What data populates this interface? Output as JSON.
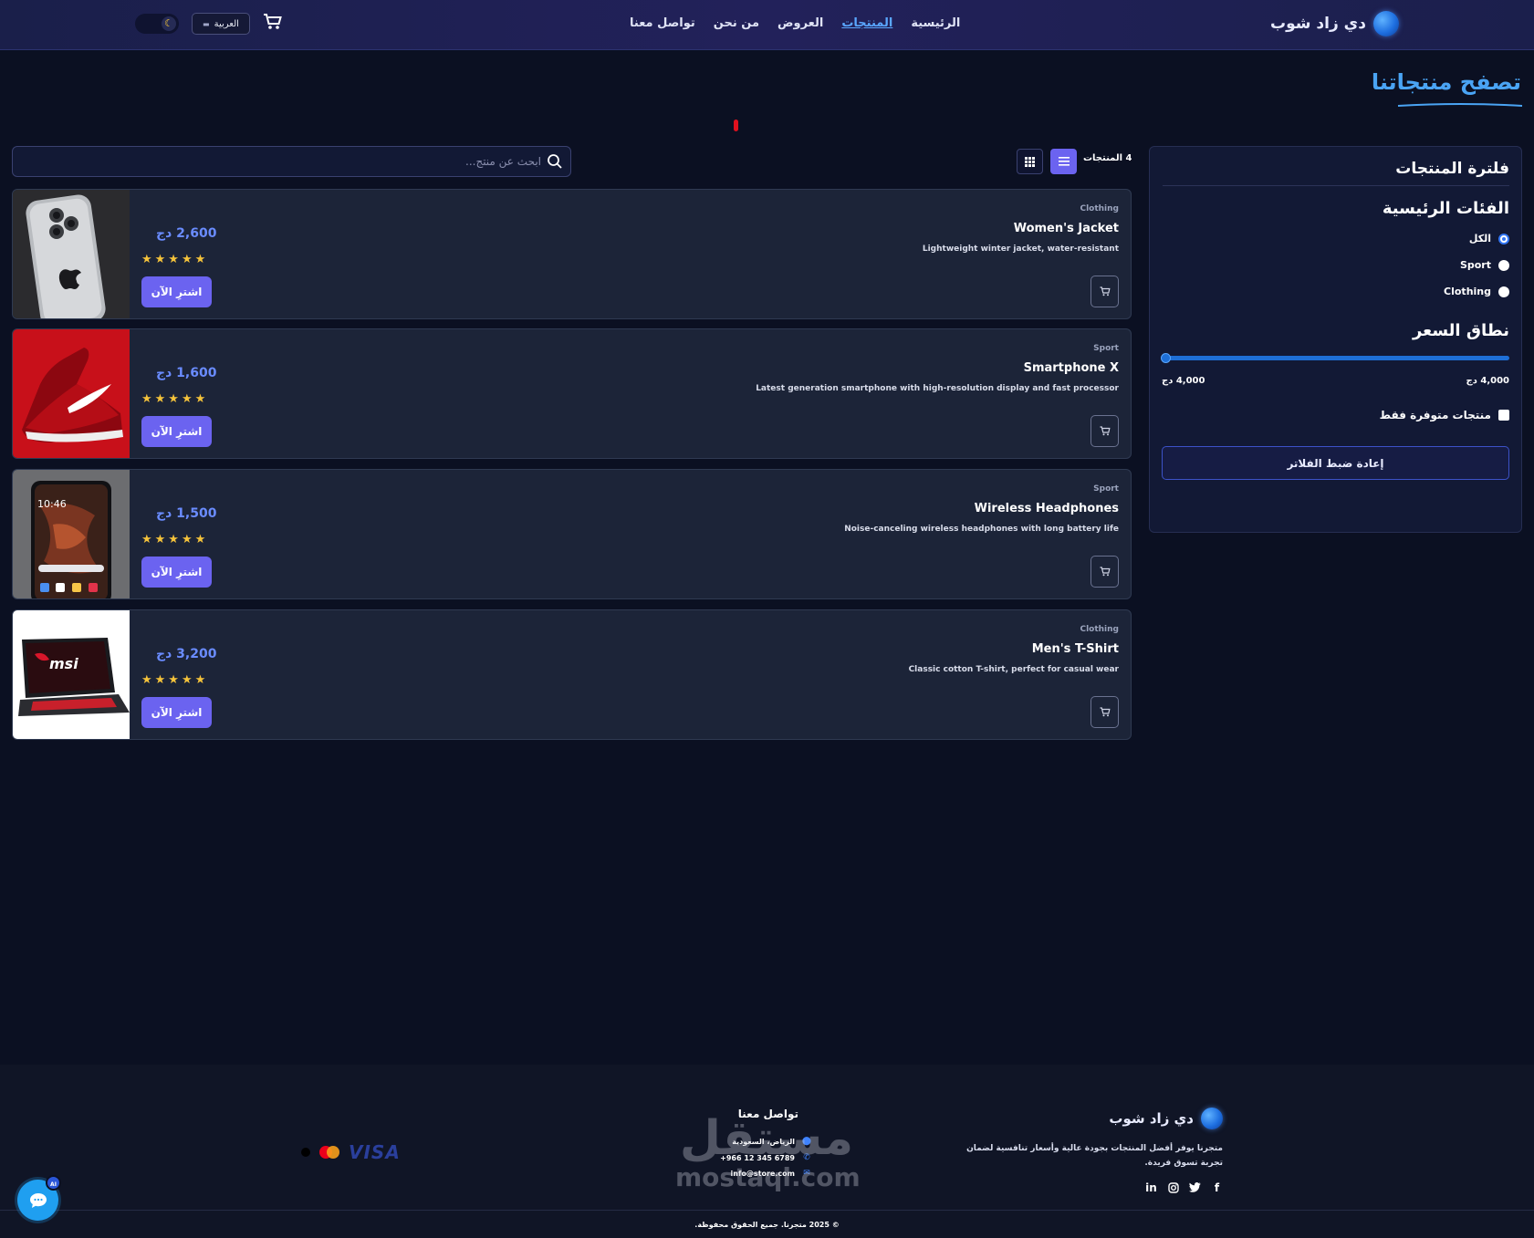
{
  "header": {
    "brand": "دي زاد شوب",
    "nav": [
      "الرئيسية",
      "المنتجات",
      "العروض",
      "من نحن",
      "تواصل معنا"
    ],
    "active_nav": "المنتجات",
    "language": "العربية"
  },
  "page": {
    "title": "تصفح منتجاتنا"
  },
  "filters": {
    "title": "فلترة المنتجات",
    "categories_title": "الفئات الرئيسية",
    "categories": [
      {
        "label": "الكل",
        "selected": true
      },
      {
        "label": "Sport",
        "selected": false
      },
      {
        "label": "Clothing",
        "selected": false
      }
    ],
    "price_title": "نطاق السعر",
    "price_min": "4,000 دج",
    "price_max": "4,000 دج",
    "in_stock_label": "منتجات متوفرة فقط",
    "reset_label": "إعادة ضبط الفلاتر"
  },
  "toolbar": {
    "count_label": "4 المنتجات",
    "search_placeholder": "ابحث عن منتج..."
  },
  "products": [
    {
      "category": "Clothing",
      "name": "Women's Jacket",
      "description": "Lightweight winter jacket, water-resistant",
      "price": "2,600 دج",
      "rating": 5,
      "buy_label": "اشترِ الآن",
      "image": "phone-back"
    },
    {
      "category": "Sport",
      "name": "Smartphone X",
      "description": "Latest generation smartphone with high-resolution display and fast processor",
      "price": "1,600 دج",
      "rating": 5,
      "buy_label": "اشترِ الآن",
      "image": "red-sneaker"
    },
    {
      "category": "Sport",
      "name": "Wireless Headphones",
      "description": "Noise-canceling wireless headphones with long battery life",
      "price": "1,500 دج",
      "rating": 5,
      "buy_label": "اشترِ الآن",
      "image": "phone-screen",
      "image_time": "10:46"
    },
    {
      "category": "Clothing",
      "name": "Men's T-Shirt",
      "description": "Classic cotton T-shirt, perfect for casual wear",
      "price": "3,200 دج",
      "rating": 5,
      "buy_label": "اشترِ الآن",
      "image": "msi-laptop",
      "image_logo": "msi"
    }
  ],
  "footer": {
    "brand": "دي زاد شوب",
    "description": "متجرنا يوفر أفضل المنتجات بجودة عالية وأسعار تنافسية لضمان تجربة تسوق فريدة.",
    "contact_title": "تواصل معنا",
    "address": "الرياض، السعودية",
    "phone": "+966 12 345 6789",
    "email": "info@store.com",
    "payment_visa": "VISA",
    "copyright": "© 2025 متجرنا. جميع الحقوق محفوظة.",
    "watermark_ar": "مستقل",
    "watermark_url": "mostaql.com",
    "chat_badge": "AI"
  },
  "colors": {
    "accent": "#6b63f0",
    "link_active": "#5aa7ff",
    "price": "#6a8cff",
    "star": "#f5c33b",
    "background": "#0b1022",
    "card": "#1c2438"
  }
}
